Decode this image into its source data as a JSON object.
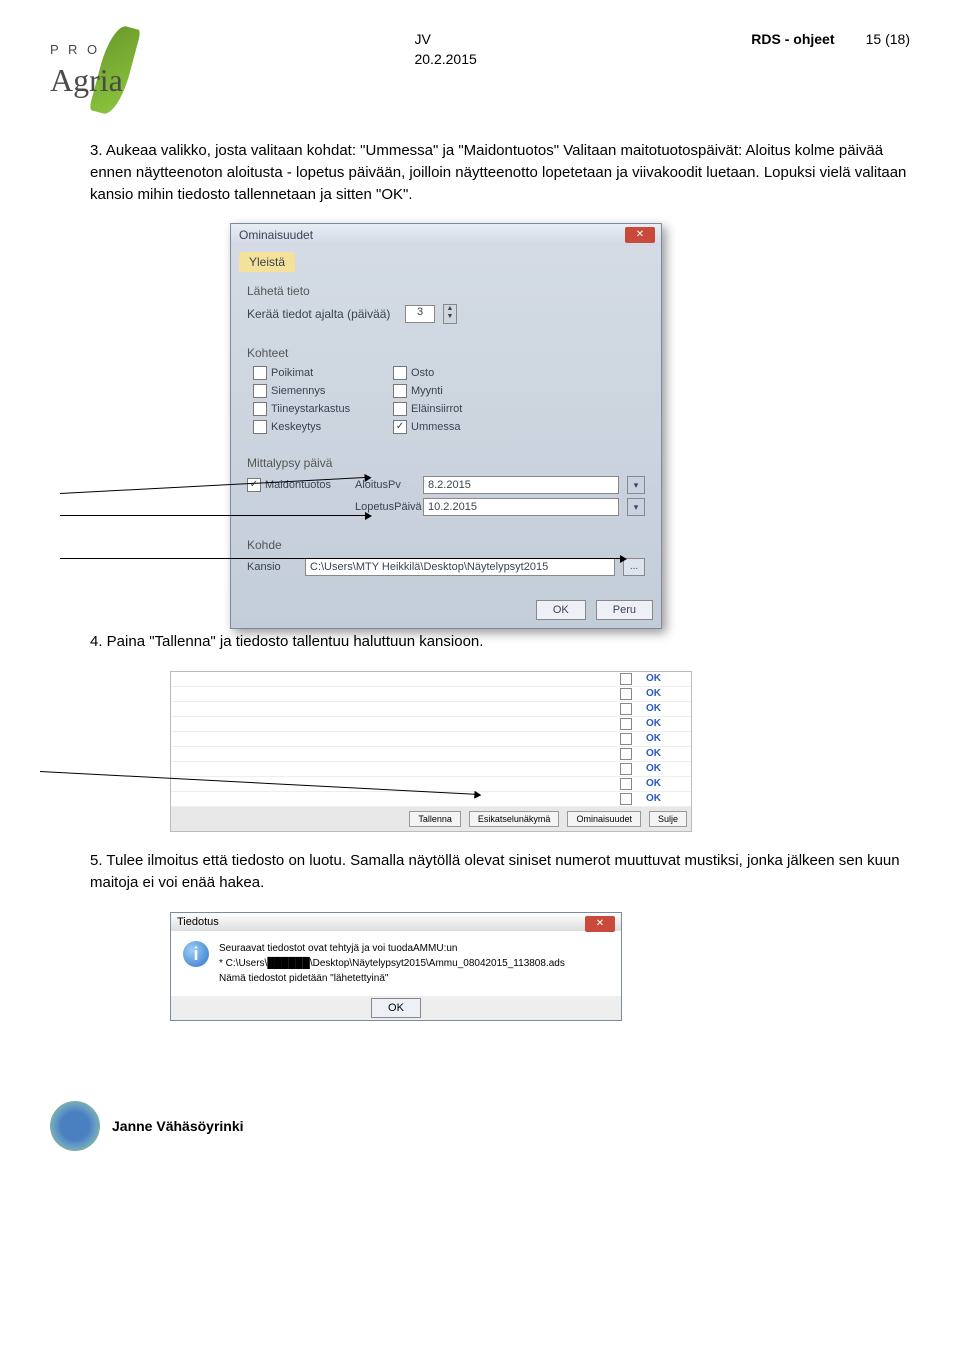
{
  "header": {
    "rds_title": "RDS - ohjeet",
    "page_num": "15 (18)",
    "jv": "JV",
    "date": "20.2.2015"
  },
  "logo": {
    "pro": "P R O",
    "agria": "Agria"
  },
  "steps": {
    "s3": "3. Aukeaa valikko, josta valitaan kohdat: \"Ummessa\" ja \"Maidontuotos\" Valitaan maitotuotospäivät: Aloitus kolme päivää ennen näytteenoton aloitusta - lopetus päivään, joilloin näytteenotto lopetetaan ja viivakoodit luetaan. Lopuksi vielä valitaan kansio mihin tiedosto tallennetaan ja sitten \"OK\".",
    "s4": "4. Paina \"Tallenna\" ja tiedosto tallentuu haluttuun kansioon.",
    "s5_a": "5. Tulee ilmoitus että tiedosto on luotu. Samalla näytöllä olevat siniset numerot muuttuvat mustiksi, jonka jälkeen sen kuun maitoja ei voi enää hakea."
  },
  "dialog": {
    "title": "Ominaisuudet",
    "tab": "Yleistä",
    "lahetatieto": "Lähetä tieto",
    "keraa": "Kerää tiedot ajalta (päivää)",
    "keraa_val": "3",
    "kohteet_title": "Kohteet",
    "chk": {
      "poikimat": "Poikimat",
      "osto": "Osto",
      "siemennys": "Siemennys",
      "myynti": "Myynti",
      "tiineys": "Tiineystarkastus",
      "elainsiirrot": "Eläinsiirrot",
      "keskeytys": "Keskeytys",
      "ummessa": "Ummessa"
    },
    "mitta_title": "Mittalypsy päivä",
    "maidontuotos": "Maidontuotos",
    "aloituspv": "AloitusPv",
    "aloituspv_val": "8.2.2015",
    "lopetuspv": "LopetusPäivä",
    "lopetuspv_val": "10.2.2015",
    "kohde_title": "Kohde",
    "kansio_lbl": "Kansio",
    "kansio_val": "C:\\Users\\MTY Heikkilä\\Desktop\\Näytelypsyt2015",
    "ok": "OK",
    "peru": "Peru"
  },
  "ok_table": {
    "ok": "OK",
    "buttons": {
      "tallenna": "Tallenna",
      "esikatselu": "Esikatselunäkymä",
      "ominaisuudet": "Ominaisuudet",
      "sulje": "Sulje"
    }
  },
  "tiedotus": {
    "title": "Tiedotus",
    "line1": "Seuraavat tiedostot ovat tehtyjä ja voi tuodaAMMU:un",
    "line2": "* C:\\Users\\██████\\Desktop\\Näytelypsyt2015\\Ammu_08042015_113808.ads",
    "line3": "Nämä tiedostot pidetään \"lähetettyinä\"",
    "ok": "OK"
  },
  "footer": {
    "name": "Janne Vähäsöyrinki"
  }
}
